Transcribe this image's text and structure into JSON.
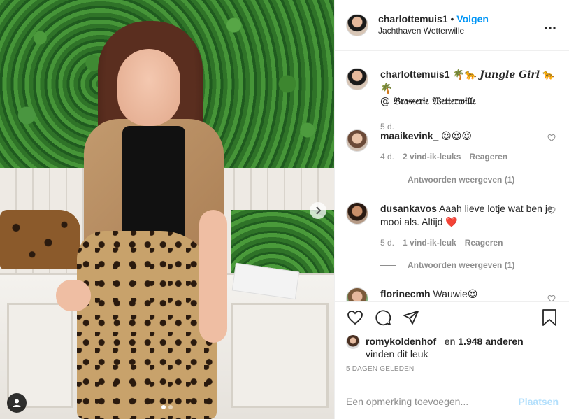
{
  "header": {
    "username": "charlottemuis1",
    "separator": "•",
    "follow_label": "Volgen",
    "location": "Jachthaven Wetterwille",
    "more_icon": "more-horizontal-icon"
  },
  "caption": {
    "username": "charlottemuis1",
    "text_part1": "🌴🐆 ",
    "text_fancy": "Jungle Girl",
    "text_part2": " 🐆🌴",
    "line2": "@ 𝔅𝔯𝔞𝔰𝔰𝔢𝔯𝔦𝔢 𝔚𝔢𝔱𝔱𝔢𝔯𝔴𝔦𝔩𝔩𝔢",
    "age": "5 d."
  },
  "comments": [
    {
      "username": "maaikevink_",
      "text": " 😍😍😍",
      "age": "4 d.",
      "likes": "2 vind-ik-leuks",
      "reply_label": "Reageren",
      "view_replies": "Antwoorden weergeven (1)"
    },
    {
      "username": "dusankavos",
      "text": " Aaah lieve lotje wat ben je mooi als. Altijd ❤️",
      "age": "5 d.",
      "likes": "1 vind-ik-leuk",
      "reply_label": "Reageren",
      "view_replies": "Antwoorden weergeven (1)"
    },
    {
      "username": "florinecmh",
      "text": " Wauwie😍"
    }
  ],
  "likes": {
    "user": "romykoldenhof_",
    "connector": " en ",
    "count": "1.948 anderen",
    "suffix": "vinden dit leuk"
  },
  "date": "5 DAGEN GELEDEN",
  "add_comment": {
    "placeholder": "Een opmerking toevoegen...",
    "post_label": "Plaatsen"
  },
  "colors": {
    "link": "#0095f6",
    "post_disabled": "#b2dffc",
    "muted": "#8e8e8e",
    "text": "#262626",
    "heart_red": "#ed4956"
  },
  "carousel": {
    "total_slides": 2,
    "active_slide": 1
  }
}
